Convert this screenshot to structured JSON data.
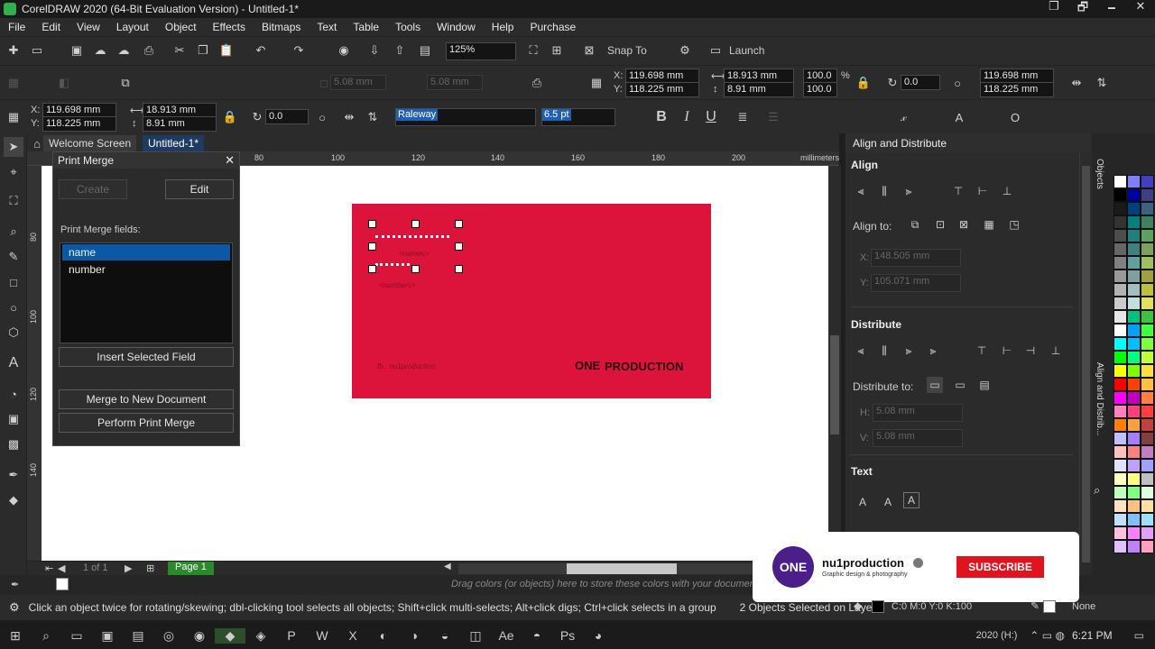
{
  "window": {
    "title": "CorelDRAW 2020 (64-Bit Evaluation Version) - Untitled-1*",
    "controls": [
      "❐",
      "🗗",
      "🗕",
      "✕"
    ]
  },
  "menu": [
    "File",
    "Edit",
    "View",
    "Layout",
    "Object",
    "Effects",
    "Bitmaps",
    "Text",
    "Table",
    "Tools",
    "Window",
    "Help",
    "Purchase"
  ],
  "toolbar1": {
    "zoom": "125%",
    "snap_to": "Snap To",
    "launch": "Launch"
  },
  "toolbar2": {
    "offset1": "5.08 mm",
    "offset2": "5.08 mm",
    "pos_x_label": "X:",
    "pos_x": "119.698 mm",
    "pos_y_label": "Y:",
    "pos_y": "118.225 mm",
    "size_w": "18.913 mm",
    "size_h": "8.91 mm",
    "scale_x": "100.0",
    "scale_y": "100.0",
    "pct": "%",
    "rotation": "0.0",
    "pos2_x": "119.698 mm",
    "pos2_y": "118.225 mm"
  },
  "toolbar3": {
    "pos_x_label": "X:",
    "pos_x": "119.698 mm",
    "pos_y_label": "Y:",
    "pos_y": "118.225 mm",
    "size_w": "18.913 mm",
    "size_h": "8.91 mm",
    "rotation": "0.0",
    "font": "Raleway",
    "font_size": "6.5 pt",
    "bold": "B",
    "italic": "I",
    "underline": "U"
  },
  "tabs": [
    {
      "label": "Welcome Screen",
      "active": false
    },
    {
      "label": "Untitled-1*",
      "active": true
    }
  ],
  "ruler": {
    "ticks": [
      "80",
      "100",
      "120",
      "140",
      "160",
      "180",
      "200"
    ],
    "unit": "millimeters",
    "left_ticks": [
      "80",
      "100",
      "120",
      "140"
    ]
  },
  "print_merge": {
    "title": "Print Merge",
    "create": "Create",
    "edit": "Edit",
    "fields_label": "Print Merge fields:",
    "fields": [
      "name",
      "number"
    ],
    "insert": "Insert Selected Field",
    "merge_new": "Merge to New Document",
    "perform": "Perform Print Merge"
  },
  "card": {
    "name_placeholder": "<names>",
    "number_placeholder": "<numbers>",
    "footer": "fb : nu1production",
    "logo_mark": "ONE",
    "logo_text": "PRODUCTION"
  },
  "pagenav": {
    "page_info": "1 of 1",
    "page_tab": "Page 1"
  },
  "palette_hint": "Drag colors (or objects) here to store these colors with your document",
  "dock": {
    "title": "Align and Distribute",
    "side_tabs": [
      "Objects",
      "Align and Distrib..."
    ],
    "align": "Align",
    "align_to": "Align to:",
    "ax": "148.505 mm",
    "ay": "105.071 mm",
    "distribute": "Distribute",
    "distribute_to": "Distribute to:",
    "dh": "5.08 mm",
    "dv": "5.08 mm",
    "text": "Text"
  },
  "status": {
    "hint": "Click an object twice for rotating/skewing; dbl-clicking tool selects all objects; Shift+click multi-selects; Alt+click digs; Ctrl+click selects in a group",
    "selection": "2 Objects Selected on Layer 1",
    "fill": "C:0 M:0 Y:0 K:100",
    "outline": "None"
  },
  "subscribe": {
    "channel": "nu1production",
    "tagline": "Graphic design & photography",
    "button": "SUBSCRIBE",
    "avatar": "ONE"
  },
  "taskbar": {
    "lang": "2020 (H:)",
    "time": "6:21 PM"
  },
  "colors": {
    "accent": "#1f5fb8",
    "page": "#dc143c",
    "subscribe": "#e0141e"
  }
}
